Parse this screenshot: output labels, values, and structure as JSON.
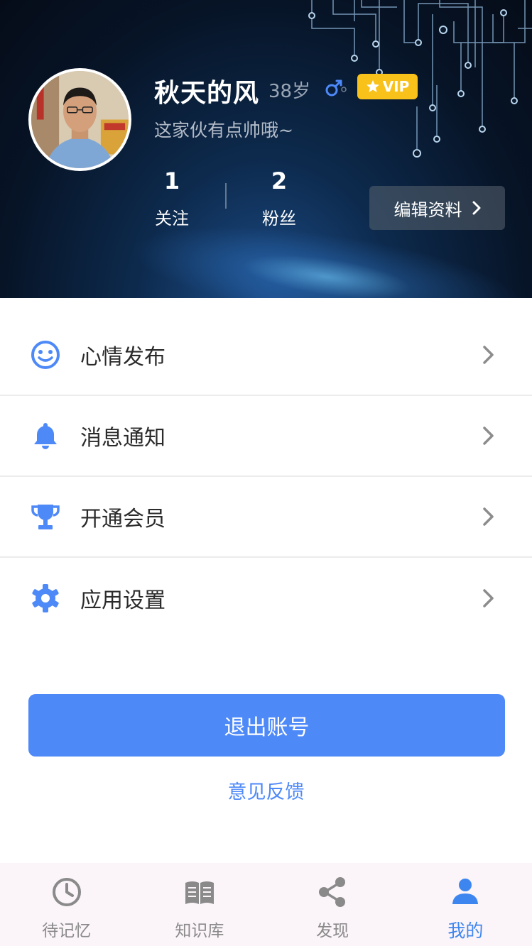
{
  "profile": {
    "name": "秋天的风",
    "age": "38岁",
    "vip_label": "VIP",
    "bio": "这家伙有点帅哦~",
    "stats": [
      {
        "value": "1",
        "label": "关注"
      },
      {
        "value": "2",
        "label": "粉丝"
      }
    ],
    "edit_label": "编辑资料"
  },
  "menu": {
    "items": [
      {
        "label": "心情发布",
        "icon": "smile-icon"
      },
      {
        "label": "消息通知",
        "icon": "bell-icon"
      },
      {
        "label": "开通会员",
        "icon": "trophy-icon"
      },
      {
        "label": "应用设置",
        "icon": "gear-icon"
      }
    ]
  },
  "actions": {
    "logout_label": "退出账号",
    "feedback_label": "意见反馈"
  },
  "tabbar": {
    "items": [
      {
        "label": "待记忆",
        "icon": "clock-icon",
        "active": false
      },
      {
        "label": "知识库",
        "icon": "book-icon",
        "active": false
      },
      {
        "label": "发现",
        "icon": "share-icon",
        "active": false
      },
      {
        "label": "我的",
        "icon": "user-icon",
        "active": true
      }
    ]
  },
  "colors": {
    "accent": "#4e89f8",
    "vip": "#f8c21b",
    "header_bg": "#071427",
    "tab_active": "#3e86ef",
    "tab_inactive": "#8a8a8a"
  }
}
